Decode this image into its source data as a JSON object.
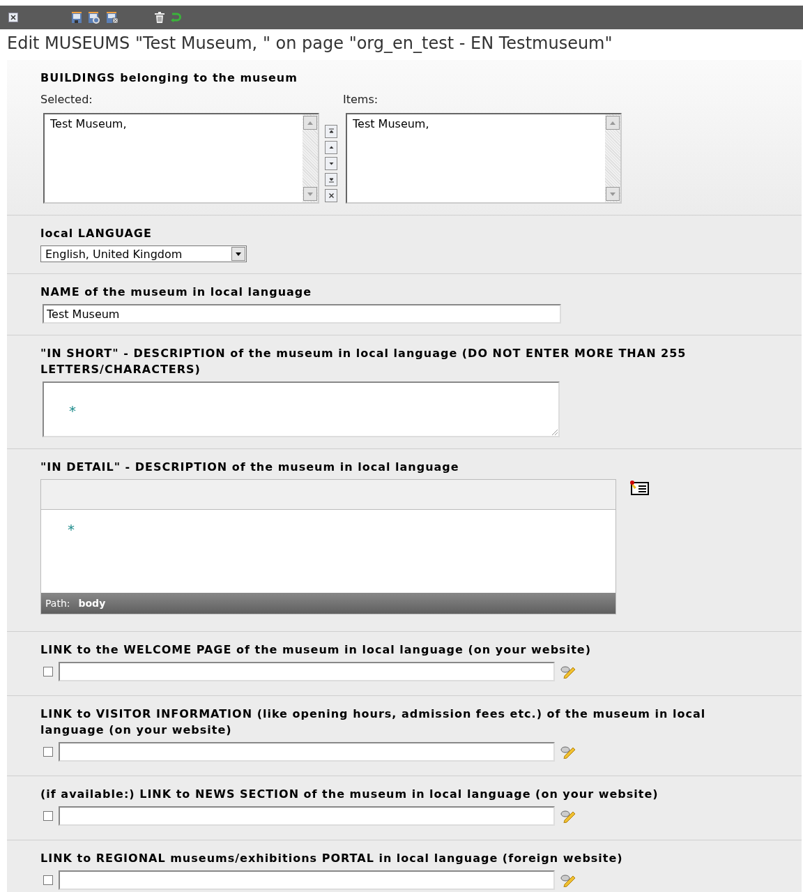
{
  "title": "Edit MUSEUMS \"Test Museum, \" on page \"org_en_test - EN Testmuseum\"",
  "sections": [
    {
      "kind": "listpair",
      "label": "BUILDINGS belonging to the museum",
      "selected_label": "Selected:",
      "selected_items": [
        "Test Museum,"
      ],
      "items_label": "Items:",
      "items": [
        "Test Museum,"
      ]
    },
    {
      "kind": "select",
      "label": "local LANGUAGE",
      "value": "English, United Kingdom"
    },
    {
      "kind": "input",
      "label": "NAME of the museum in local language",
      "value": "Test Museum"
    },
    {
      "kind": "textarea",
      "label": "\"IN SHORT\" - DESCRIPTION of the museum in local language (DO NOT ENTER MORE THAN 255 LETTERS/CHARACTERS)",
      "marker": "*"
    },
    {
      "kind": "rte",
      "label": "\"IN DETAIL\" - DESCRIPTION of the museum in local language",
      "marker": "*",
      "path_label": "Path:",
      "path": "body"
    },
    {
      "kind": "link",
      "label": "LINK to the WELCOME PAGE of the museum in local language (on your website)",
      "checked": false
    },
    {
      "kind": "link",
      "label": "LINK to VISITOR INFORMATION (like opening hours, admission fees etc.) of the museum in local language (on your website)",
      "checked": false
    },
    {
      "kind": "link",
      "label": "(if available:) LINK to NEWS SECTION of the museum in local language (on your website)",
      "checked": false
    },
    {
      "kind": "link",
      "label": "LINK to REGIONAL museums/exhibitions PORTAL in local language (foreign website)",
      "checked": false
    }
  ]
}
